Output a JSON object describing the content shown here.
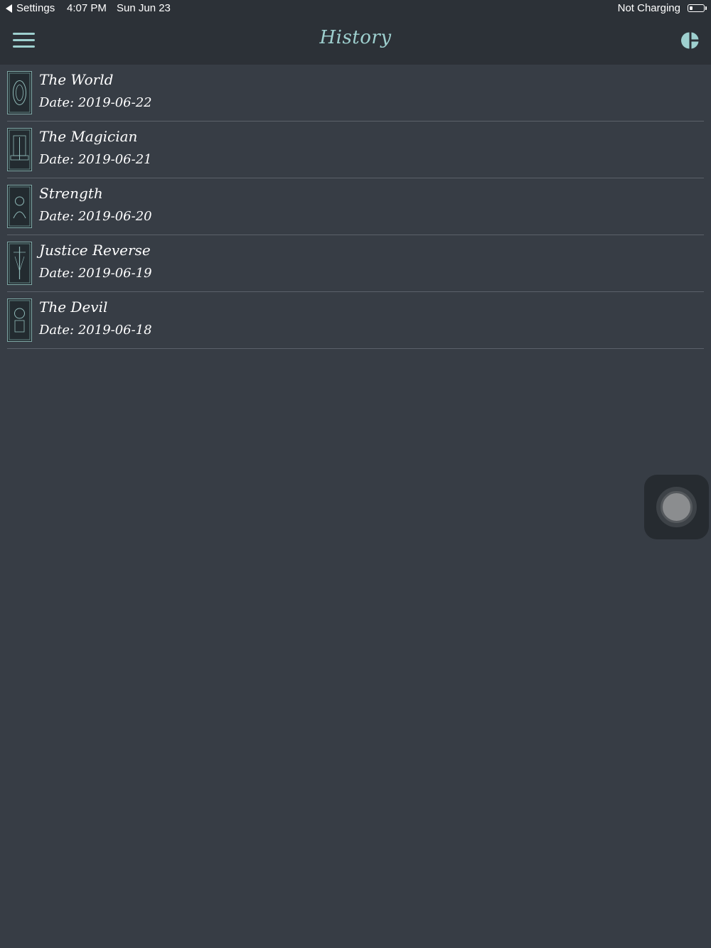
{
  "status_bar": {
    "back_label": "Settings",
    "time": "4:07 PM",
    "date": "Sun Jun 23",
    "charging": "Not Charging",
    "battery_level": 0.2
  },
  "header": {
    "title": "History",
    "menu_icon": "hamburger-menu-icon",
    "stats_icon": "pie-chart-icon"
  },
  "colors": {
    "accent": "#9ed0cf",
    "background": "#373d45",
    "header_background": "#2c3137"
  },
  "history": {
    "items": [
      {
        "name": "The World",
        "date": "Date: 2019-06-22"
      },
      {
        "name": "The Magician",
        "date": "Date: 2019-06-21"
      },
      {
        "name": "Strength",
        "date": "Date: 2019-06-20"
      },
      {
        "name": "Justice Reverse",
        "date": "Date: 2019-06-19"
      },
      {
        "name": "The Devil",
        "date": "Date: 2019-06-18"
      }
    ]
  }
}
